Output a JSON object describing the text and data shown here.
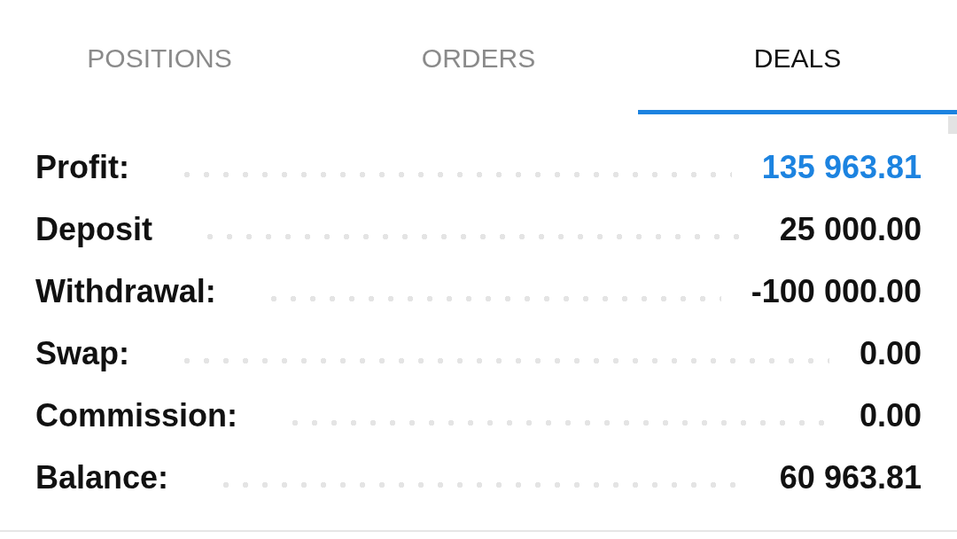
{
  "tabs": [
    {
      "label": "POSITIONS",
      "selected": false
    },
    {
      "label": "ORDERS",
      "selected": false
    },
    {
      "label": "DEALS",
      "selected": true
    }
  ],
  "summary": {
    "rows": [
      {
        "label": "Profit:",
        "value": "135 963.81",
        "highlighted": true
      },
      {
        "label": "Deposit",
        "value": "25 000.00",
        "highlighted": false
      },
      {
        "label": "Withdrawal:",
        "value": "-100 000.00",
        "highlighted": false
      },
      {
        "label": "Swap:",
        "value": "0.00",
        "highlighted": false
      },
      {
        "label": "Commission:",
        "value": "0.00",
        "highlighted": false
      },
      {
        "label": "Balance:",
        "value": "60 963.81",
        "highlighted": false
      }
    ]
  }
}
